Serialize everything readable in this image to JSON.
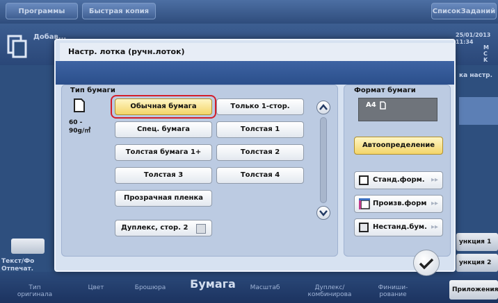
{
  "topbar": {
    "programs": "Программы",
    "quick_copy": "Быстрая копия",
    "job_list": "СписокЗаданий"
  },
  "background": {
    "add_paper": "Добав...",
    "counter_date": "25/01/2013",
    "counter_time": "11:34",
    "line2": "M",
    "line3": "C",
    "line4": "K",
    "settings_frag": "ка настр.",
    "func1": "ункция 1",
    "func2": "ункция 2",
    "text_photo": "Текст/Фо",
    "printed": "Отпечат."
  },
  "bottom_tabs": [
    "Тип\nоригинала",
    "Цвет",
    "Брошюра",
    "Бумага",
    "Масштаб",
    "Дуплекс/\nкомбинирова",
    "Финиши-\nрование",
    "Приложения"
  ],
  "dialog": {
    "title": "Настр. лотка (ручн.лоток)",
    "paper_type_label": "Тип бумаги",
    "paper_weight": "60 -\n90g/㎡",
    "paper_types": [
      "Обычная бумага",
      "Только 1-стор.",
      "Спец. бумага",
      "Толстая 1",
      "Толстая бумага 1+",
      "Толстая 2",
      "Толстая 3",
      "Толстая 4",
      "Прозрачная пленка",
      "Дуплекс, стор. 2"
    ],
    "paper_size_label": "Формат бумаги",
    "current_size": "A4",
    "auto_detect": "Автоопределение",
    "size_options": [
      "Станд.форм.",
      "Произв.форм",
      "Нестанд.бум."
    ]
  },
  "colors": {
    "selected_button": "#f3d56a",
    "highlight_ring": "#d41e2a",
    "dialog_band": "#2b4f8b"
  }
}
